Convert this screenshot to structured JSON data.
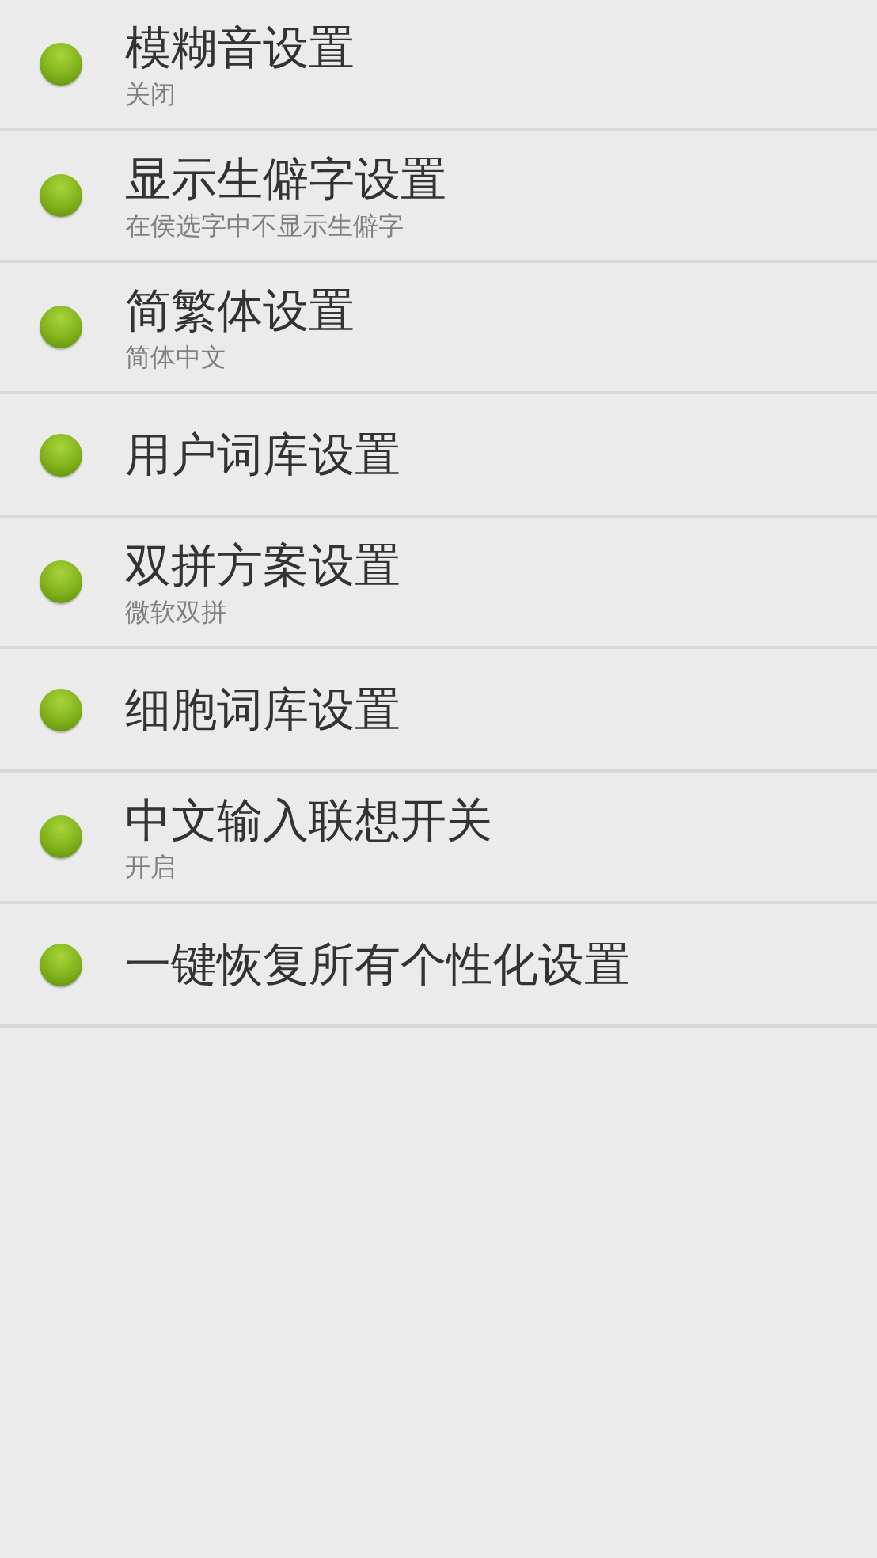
{
  "settings": [
    {
      "title": "模糊音设置",
      "summary": "关闭"
    },
    {
      "title": "显示生僻字设置",
      "summary": "在侯选字中不显示生僻字"
    },
    {
      "title": "简繁体设置",
      "summary": "简体中文"
    },
    {
      "title": "用户词库设置"
    },
    {
      "title": "双拼方案设置",
      "summary": "微软双拼"
    },
    {
      "title": "细胞词库设置"
    },
    {
      "title": "中文输入联想开关",
      "summary": "开启"
    },
    {
      "title": "一键恢复所有个性化设置"
    }
  ]
}
